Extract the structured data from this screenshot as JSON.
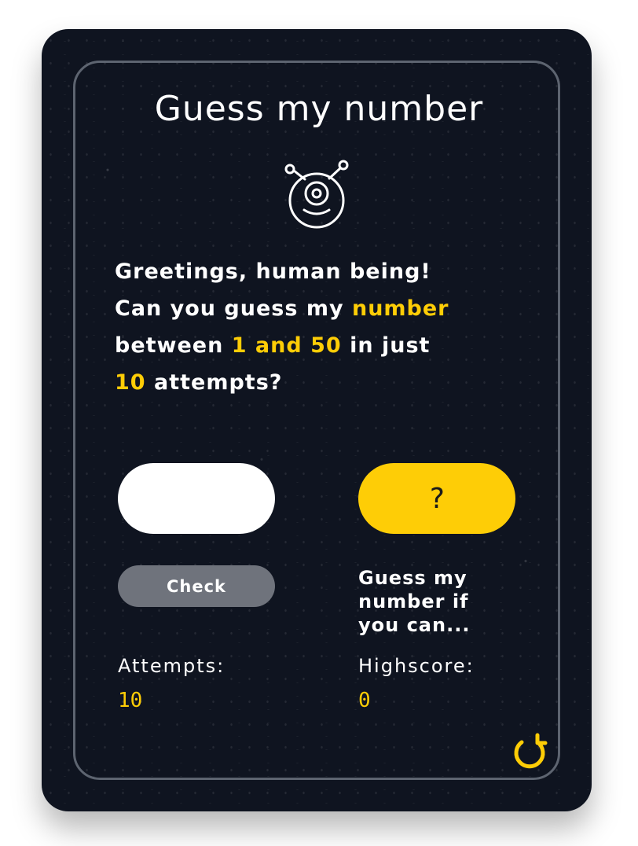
{
  "game": {
    "title": "Guess my number",
    "intro": {
      "line1": "Greetings, human being!",
      "line2_text": "Can you guess my ",
      "line2_highlight": "number",
      "line3_text_before": "between ",
      "line3_highlight": "1 and 50",
      "line3_text_after": " in just",
      "line4_highlight": "10",
      "line4_text": " attempts?"
    },
    "input": {
      "value": "",
      "placeholder": ""
    },
    "secret_display": "?",
    "check_label": "Check",
    "message": "Guess my number if you can...",
    "attempts": {
      "label": "Attempts:",
      "value": "10"
    },
    "highscore": {
      "label": "Highscore:",
      "value": "0"
    }
  },
  "icons": {
    "mascot": "alien-icon",
    "reset": "reset-icon"
  },
  "colors": {
    "accent": "#fecd06",
    "card_background": "#0f1420",
    "button_gray": "#6f737c",
    "frame_border": "#5d6470",
    "text": "#ffffff"
  }
}
